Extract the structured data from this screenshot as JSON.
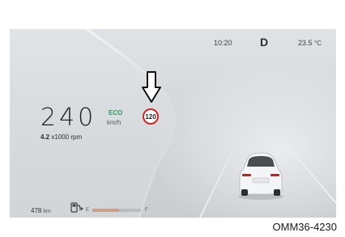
{
  "status_bar": {
    "time": "10:20",
    "gear": "D",
    "temperature_value": "23.5",
    "temperature_unit": "°C"
  },
  "speedometer": {
    "speed": "240",
    "mode": "ECO",
    "unit": "km/h",
    "rpm_value": "4.2",
    "rpm_unit": "x1000 rpm"
  },
  "speed_limit_sign": {
    "value": "120",
    "border_color": "#d3241f"
  },
  "fuel": {
    "range_value": "478",
    "range_unit": "km",
    "empty_label": "E",
    "full_label": "F",
    "level_fraction": 0.55,
    "fill_color": "#c9a08c"
  },
  "icons": {
    "arrow": "down-arrow-icon",
    "fuel": "fuel-pump-icon",
    "vehicle": "car-rear-icon"
  },
  "caption": "OMM36-4230",
  "colors": {
    "eco": "#2f9a55",
    "screen_background": "#d6dadd"
  }
}
